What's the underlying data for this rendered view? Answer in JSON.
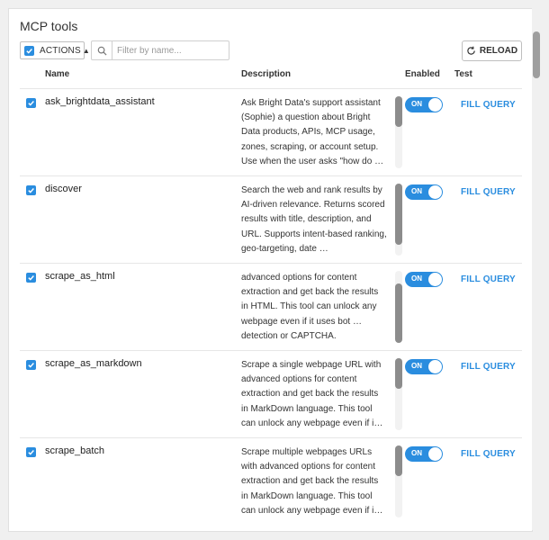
{
  "panel": {
    "title": "MCP tools",
    "actions_label": "ACTIONS",
    "filter_placeholder": "Filter by name...",
    "reload_label": "RELOAD"
  },
  "columns": {
    "name": "Name",
    "description": "Description",
    "enabled": "Enabled",
    "test": "Test"
  },
  "rows": [
    {
      "name": "ask_brightdata_assistant",
      "description": "Ask Bright Data's support assistant (Sophie) a question about Bright Data products, APIs, MCP usage, zones, scraping, or account setup. Use when the user asks \"how do …",
      "checked": true,
      "toggle_label": "ON",
      "test_label": "FILL QUERY"
    },
    {
      "name": "discover",
      "description": "Search the web and rank results by AI-driven relevance. Returns scored results with title, description, and URL. Supports intent-based ranking, geo-targeting, date …",
      "checked": true,
      "toggle_label": "ON",
      "test_label": "FILL QUERY"
    },
    {
      "name": "scrape_as_html",
      "description": "advanced options for content extraction and get back the results in HTML. This tool can unlock any webpage even if it uses bot … detection or CAPTCHA.",
      "checked": true,
      "toggle_label": "ON",
      "test_label": "FILL QUERY"
    },
    {
      "name": "scrape_as_markdown",
      "description": "Scrape a single webpage URL with advanced options for content extraction and get back the results in MarkDown language. This tool can unlock any webpage even if i…",
      "checked": true,
      "toggle_label": "ON",
      "test_label": "FILL QUERY"
    },
    {
      "name": "scrape_batch",
      "description": "Scrape multiple webpages URLs with advanced options for content extraction and get back the results in MarkDown language. This tool can unlock any webpage even if i…",
      "checked": true,
      "toggle_label": "ON",
      "test_label": "FILL QUERY"
    }
  ],
  "colors": {
    "accent": "#2a8ddf",
    "scroll_thumb": "#8c8c8c"
  },
  "icons": {
    "checkbox": "checkbox-checked-icon",
    "search": "search-icon",
    "reload": "refresh-icon",
    "caret": "caret-up-icon"
  }
}
